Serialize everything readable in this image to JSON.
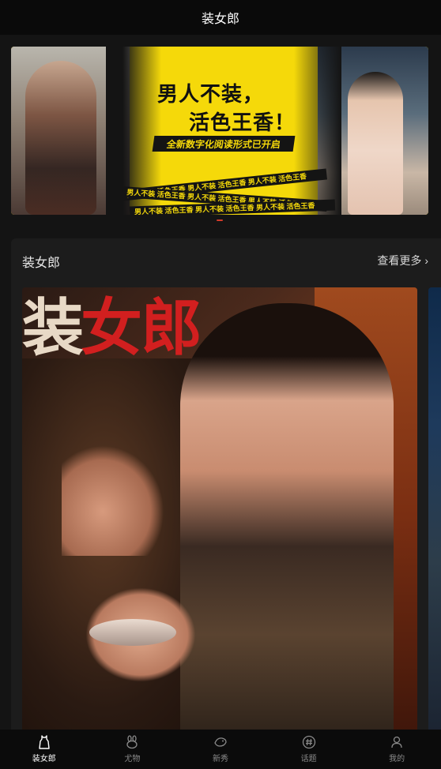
{
  "header": {
    "title": "装女郎"
  },
  "banner": {
    "headline_line1": "男人不装，",
    "headline_line2": "活色王香！",
    "slogan": "全新数字化阅读形式已开启",
    "tape_text": "男人不装 活色王香 男人不装 活色王香 男人不装 活色王香",
    "colors": {
      "accent": "#f5d90a",
      "ink": "#141414"
    }
  },
  "carousel": {
    "active_index": 0,
    "indicator_color": "#d23a2a"
  },
  "section": {
    "title": "装女郎",
    "more_label": "查看更多",
    "more_chevron": "›"
  },
  "cover": {
    "masthead_part1": "装",
    "masthead_part2": "女郎"
  },
  "tabbar": {
    "items": [
      {
        "label": "装女郎",
        "icon": "dress-icon",
        "active": true
      },
      {
        "label": "尤物",
        "icon": "bunny-icon",
        "active": false
      },
      {
        "label": "新秀",
        "icon": "bird-icon",
        "active": false
      },
      {
        "label": "话题",
        "icon": "hashtag-icon",
        "active": false
      },
      {
        "label": "我的",
        "icon": "profile-icon",
        "active": false
      }
    ]
  }
}
